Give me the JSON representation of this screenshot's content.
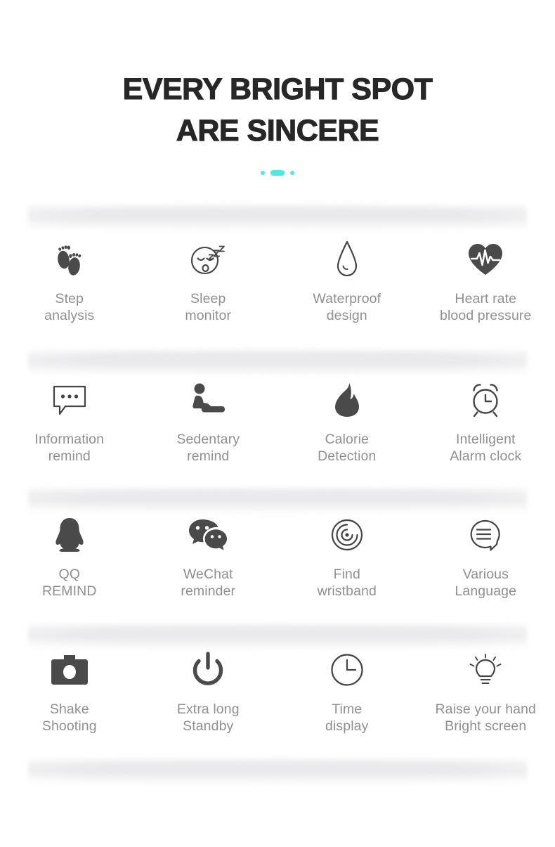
{
  "header": {
    "title_line_1": "EVERY BRIGHT SPOT",
    "title_line_2": "ARE SINCERE",
    "accent_color": "#4fe8e0",
    "title_color": "#272727"
  },
  "theme": {
    "background": "#ffffff",
    "band_color": "#e9e9eb",
    "label_color": "#909090",
    "icon_dark": "#4a4a4a",
    "icon_outline": "#444444"
  },
  "features": {
    "label_color": "#909090",
    "rows": [
      {
        "cells": [
          {
            "icon": "footprints-icon",
            "label": "Step\nanalysis"
          },
          {
            "icon": "sleeping-face-icon",
            "label": "Sleep\nmonitor"
          },
          {
            "icon": "water-drop-icon",
            "label": "Waterproof\ndesign"
          },
          {
            "icon": "heart-pulse-icon",
            "label": "Heart rate\nblood pressure"
          }
        ]
      },
      {
        "cells": [
          {
            "icon": "speech-bubble-dots-icon",
            "label": "Information\nremind"
          },
          {
            "icon": "sitting-person-icon",
            "label": "Sedentary\nremind"
          },
          {
            "icon": "flame-icon",
            "label": "Calorie\nDetection"
          },
          {
            "icon": "alarm-clock-icon",
            "label": "Intelligent\nAlarm clock"
          }
        ]
      },
      {
        "cells": [
          {
            "icon": "qq-penguin-icon",
            "label": "QQ\nREMIND"
          },
          {
            "icon": "wechat-bubbles-icon",
            "label": "WeChat\nreminder"
          },
          {
            "icon": "find-wristband-icon",
            "label": "Find\nwristband"
          },
          {
            "icon": "speech-bubble-lines-icon",
            "label": "Various\nLanguage"
          }
        ]
      },
      {
        "cells": [
          {
            "icon": "camera-icon",
            "label": "Shake\nShooting"
          },
          {
            "icon": "power-icon",
            "label": "Extra long\nStandby"
          },
          {
            "icon": "clock-icon",
            "label": "Time\ndisplay"
          },
          {
            "icon": "light-bulb-icon",
            "label": "Raise your hand\nBright screen"
          }
        ]
      }
    ]
  }
}
